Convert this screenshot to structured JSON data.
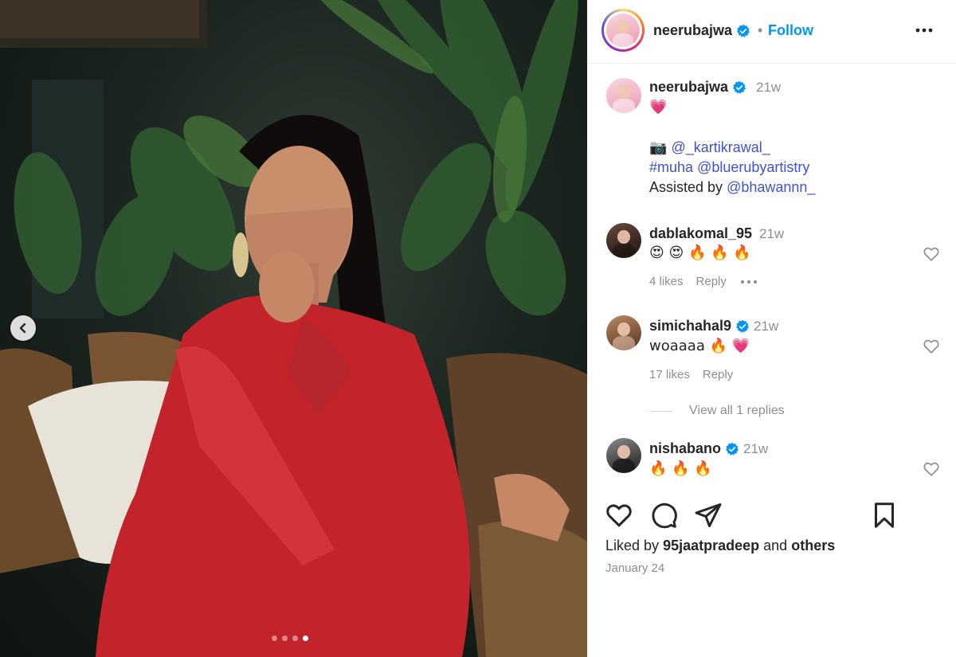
{
  "post": {
    "author": "neerubajwa",
    "follow_label": "Follow",
    "separator": "•",
    "carousel": {
      "total_slides": 4,
      "active_slide": 4
    }
  },
  "caption": {
    "username": "neerubajwa",
    "time": "21w",
    "line1": "💗",
    "camera_emoji": "📷",
    "mention_photographer": "@_kartikrawal_",
    "hashtag": "#muha",
    "mention_makeup": "@bluerubyartistry",
    "assisted_prefix": "Assisted by",
    "mention_assistant": "@bhawannn_"
  },
  "comments": [
    {
      "username": "dablakomal_95",
      "time": "21w",
      "text": "😍 😍 🔥 🔥 🔥",
      "likes": "4 likes",
      "reply": "Reply",
      "verified": false
    },
    {
      "username": "simichahal9",
      "time": "21w",
      "text": "woaaaa 🔥 💗",
      "likes": "17 likes",
      "reply": "Reply",
      "verified": true
    },
    {
      "username": "nishabano",
      "time": "21w",
      "text": "🔥 🔥 🔥",
      "verified": true
    }
  ],
  "view_replies": "View all 1 replies",
  "liked_by": {
    "prefix": "Liked by",
    "user": "95jaatpradeep",
    "and": "and",
    "others": "others"
  },
  "date": "January 24",
  "colors": {
    "accent": "#0095f6",
    "link": "#3f51d6",
    "muted": "#8e8e8e",
    "verified": "#0095f6"
  },
  "icons": [
    "more-icon",
    "verified-icon",
    "heart-icon",
    "comment-icon",
    "share-icon",
    "bookmark-icon",
    "chevron-left-icon"
  ]
}
